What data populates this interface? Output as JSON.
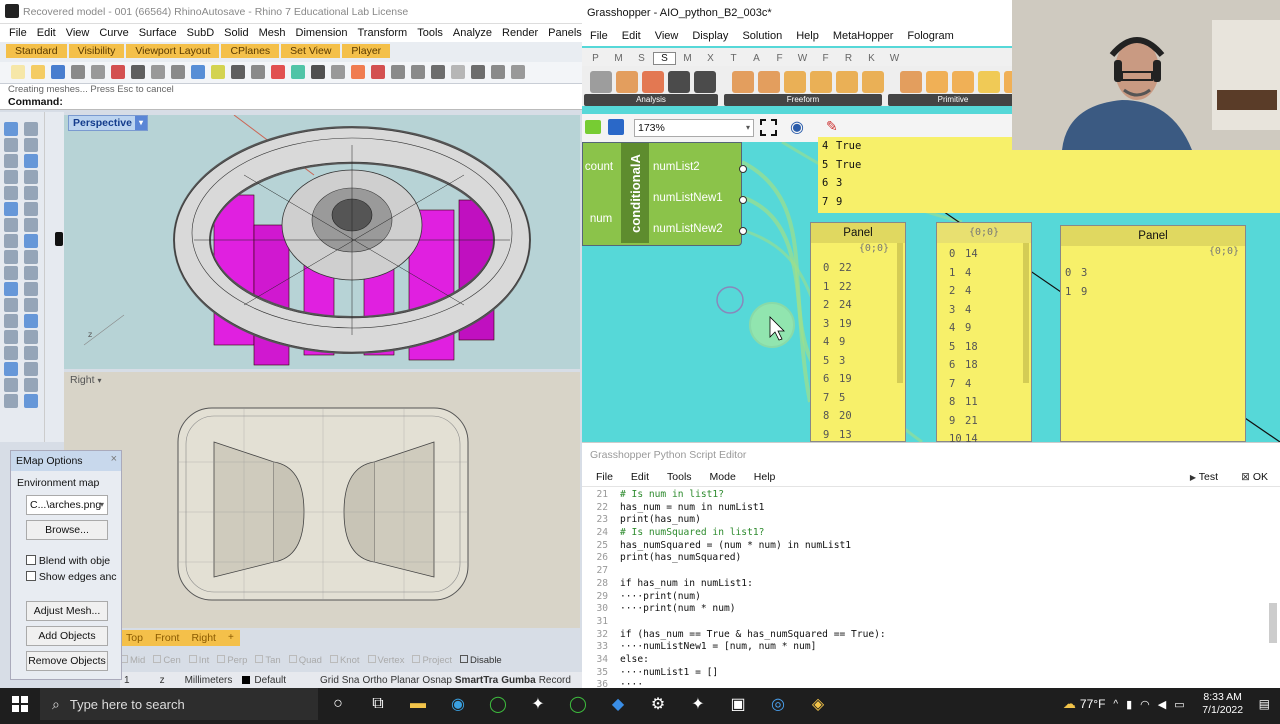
{
  "rhino": {
    "title": "Recovered model - 001 (66564) RhinoAutosave - Rhino 7 Educational Lab License",
    "menu": [
      "File",
      "Edit",
      "View",
      "Curve",
      "Surface",
      "SubD",
      "Solid",
      "Mesh",
      "Dimension",
      "Transform",
      "Tools",
      "Analyze",
      "Render",
      "Panels",
      "Paneling Toc"
    ],
    "tabs": [
      "Standard",
      "Visibility",
      "Viewport Layout",
      "CPlanes",
      "Set View",
      "Player"
    ],
    "status_line": "Creating meshes... Press Esc to cancel",
    "command_label": "Command:",
    "viewport_perspective": "Perspective",
    "viewport_right": "Right",
    "view_tabs": [
      "Top",
      "Front",
      "Right"
    ],
    "osnaps": [
      "Mid",
      "Cen",
      "Int",
      "Perp",
      "Tan",
      "Quad",
      "Knot",
      "Vertex",
      "Project"
    ],
    "disable_label": "Disable",
    "status_cplane": "1",
    "status_z": "z",
    "status_units": "Millimeters",
    "status_layer": "Default",
    "status_toggles": [
      "Grid Sna",
      "Ortho",
      "Planar",
      "Osnap",
      "SmartTra",
      "Gumba",
      "Record"
    ],
    "emap": {
      "title": "EMap Options",
      "env_label": "Environment map",
      "env_value": "C...\\arches.png",
      "browse": "Browse...",
      "blend": "Blend with obje",
      "show_edges": "Show edges anc",
      "adjust": "Adjust Mesh...",
      "add": "Add Objects",
      "remove": "Remove Objects"
    },
    "accent_color": "#f4c04a",
    "object_color": "#e020e0"
  },
  "grasshopper": {
    "title": "Grasshopper - AIO_python_B2_003c*",
    "menu": [
      "File",
      "Edit",
      "View",
      "Display",
      "Solution",
      "Help",
      "MetaHopper",
      "Fologram"
    ],
    "tab_letters": [
      "P",
      "M",
      "S",
      "S",
      "M",
      "X",
      "T",
      "A",
      "F",
      "W",
      "F",
      "R",
      "K",
      "W"
    ],
    "group_labels": [
      "Analysis",
      "Freeform",
      "Primitive"
    ],
    "zoom": "173%",
    "component": {
      "name": "conditionalA",
      "inputs": [
        "count",
        "num"
      ],
      "outputs": [
        "numList2",
        "numListNew1",
        "numListNew2"
      ]
    },
    "panel_top": [
      {
        "i": "4",
        "v": "True"
      },
      {
        "i": "5",
        "v": "True"
      },
      {
        "i": "6",
        "v": "3"
      },
      {
        "i": "7",
        "v": "9"
      }
    ],
    "panel1": {
      "title": "Panel",
      "path": "{0;0}",
      "rows": [
        [
          "0",
          "22"
        ],
        [
          "1",
          "22"
        ],
        [
          "2",
          "24"
        ],
        [
          "3",
          "19"
        ],
        [
          "4",
          "9"
        ],
        [
          "5",
          "3"
        ],
        [
          "6",
          "19"
        ],
        [
          "7",
          "5"
        ],
        [
          "8",
          "20"
        ],
        [
          "9",
          "13"
        ]
      ]
    },
    "panel2": {
      "path": "{0;0}",
      "rows": [
        [
          "0",
          "14"
        ],
        [
          "1",
          "4"
        ],
        [
          "2",
          "4"
        ],
        [
          "3",
          "4"
        ],
        [
          "4",
          "9"
        ],
        [
          "5",
          "18"
        ],
        [
          "6",
          "18"
        ],
        [
          "7",
          "4"
        ],
        [
          "8",
          "11"
        ],
        [
          "9",
          "21"
        ],
        [
          "10",
          "14"
        ]
      ]
    },
    "panel3": {
      "title": "Panel",
      "path": "{0;0}",
      "rows": [
        [
          "0",
          "3"
        ],
        [
          "1",
          "9"
        ]
      ]
    },
    "canvas_color": "#56d8d8",
    "panel_color": "#f7f06a"
  },
  "editor": {
    "title": "Grasshopper Python Script Editor",
    "menu": [
      "File",
      "Edit",
      "Tools",
      "Mode",
      "Help"
    ],
    "test": "Test",
    "ok": "OK",
    "lines": [
      {
        "n": "21",
        "t": "# Is num in list1?"
      },
      {
        "n": "22",
        "t": "has_num = num in numList1"
      },
      {
        "n": "23",
        "t": "print(has_num)"
      },
      {
        "n": "24",
        "t": "# Is numSquared in list1?"
      },
      {
        "n": "25",
        "t": "has_numSquared = (num * num) in numList1"
      },
      {
        "n": "26",
        "t": "print(has_numSquared)"
      },
      {
        "n": "27",
        "t": ""
      },
      {
        "n": "28",
        "t": "if has_num in numList1:"
      },
      {
        "n": "29",
        "t": "····print(num)"
      },
      {
        "n": "30",
        "t": "····print(num * num)"
      },
      {
        "n": "31",
        "t": ""
      },
      {
        "n": "32",
        "t": "if (has_num == True & has_numSquared == True):"
      },
      {
        "n": "33",
        "t": "····numListNew1 = [num, num * num]"
      },
      {
        "n": "34",
        "t": "else:"
      },
      {
        "n": "35",
        "t": "····numList1 = []"
      },
      {
        "n": "36",
        "t": "····"
      }
    ]
  },
  "taskbar": {
    "search_placeholder": "Type here to search",
    "weather": "77°F",
    "time": "8:33 AM",
    "date": "7/1/2022"
  }
}
